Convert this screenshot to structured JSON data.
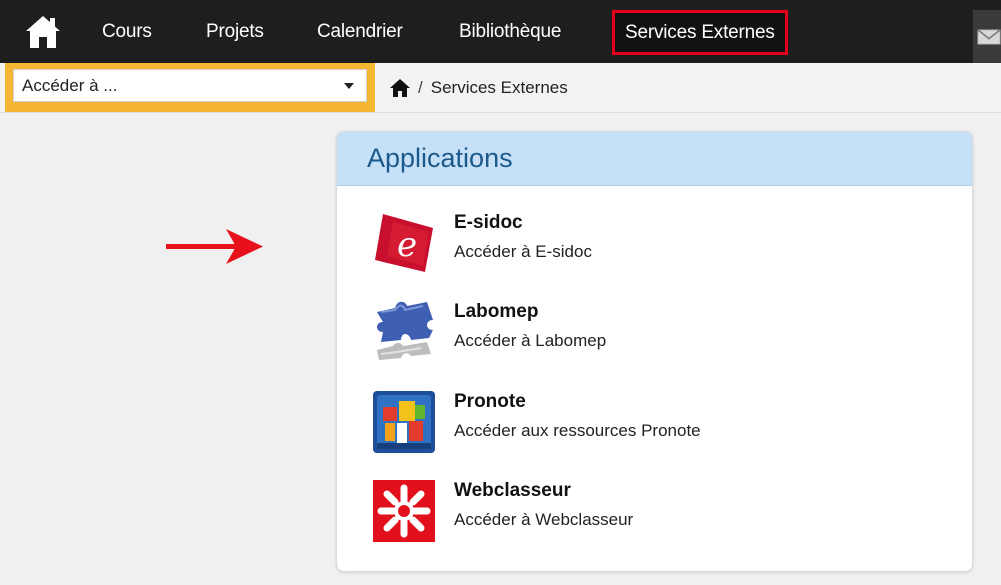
{
  "nav": {
    "home_icon": "home-icon",
    "items": [
      "Cours",
      "Projets",
      "Calendrier",
      "Bibliothèque"
    ],
    "active": "Services Externes",
    "mail_icon": "mail-icon",
    "highlight_color": "#e3001b"
  },
  "goto": {
    "placeholder": "Accéder à ..."
  },
  "breadcrumb": {
    "home_icon": "home-icon",
    "separator": "/",
    "current": "Services Externes"
  },
  "panel": {
    "title": "Applications",
    "apps": [
      {
        "name": "E-sidoc",
        "description": "Accéder à E-sidoc",
        "icon": "esidoc-icon"
      },
      {
        "name": "Labomep",
        "description": "Accéder à Labomep",
        "icon": "labomep-puzzle-icon"
      },
      {
        "name": "Pronote",
        "description": "Accéder aux ressources Pronote",
        "icon": "pronote-icon"
      },
      {
        "name": "Webclasseur",
        "description": "Accéder à Webclasseur",
        "icon": "webclasseur-icon"
      }
    ]
  },
  "annotation": {
    "arrow_icon": "red-arrow-icon",
    "arrow_color": "#e8101a"
  }
}
